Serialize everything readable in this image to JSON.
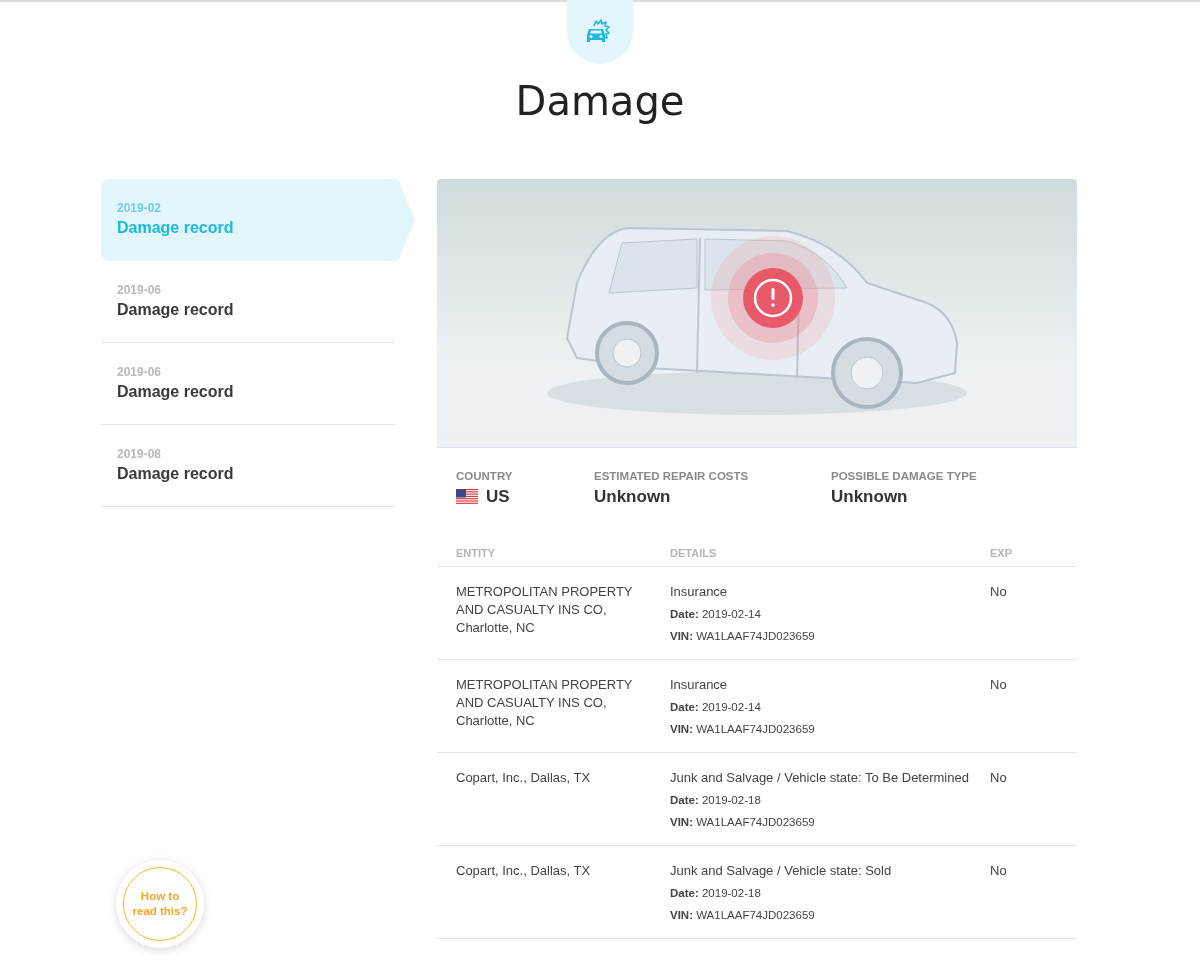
{
  "header": {
    "title": "Damage"
  },
  "records": [
    {
      "date": "2019-02",
      "label": "Damage record",
      "selected": true
    },
    {
      "date": "2019-06",
      "label": "Damage record",
      "selected": false
    },
    {
      "date": "2019-06",
      "label": "Damage record",
      "selected": false
    },
    {
      "date": "2019-08",
      "label": "Damage record",
      "selected": false
    }
  ],
  "summary": [
    {
      "kind": "flag",
      "label": "COUNTRY",
      "value": "US"
    },
    {
      "kind": "text",
      "label": "ESTIMATED REPAIR COSTS",
      "value": "Unknown"
    },
    {
      "kind": "text",
      "label": "POSSIBLE DAMAGE TYPE",
      "value": "Unknown"
    }
  ],
  "table": {
    "columns": [
      "ENTITY",
      "DETAILS",
      "EXP"
    ],
    "rows": [
      {
        "entity": "METROPOLITAN PROPERTY AND CASUALTY INS CO, Charlotte, NC",
        "details": "Insurance",
        "date": "**Date:** 2019-02-14",
        "vin": "**VIN:** WA1LAAF74JD023659",
        "exp": "No"
      },
      {
        "entity": "METROPOLITAN PROPERTY AND CASUALTY INS CO, Charlotte, NC",
        "details": "Insurance",
        "date": "**Date:** 2019-02-14",
        "vin": "**VIN:** WA1LAAF74JD023659",
        "exp": "No"
      },
      {
        "entity": "Copart, Inc., Dallas, TX",
        "details": "Junk and Salvage / Vehicle state: To Be Determined",
        "date": "**Date:** 2019-02-18",
        "vin": "**VIN:** WA1LAAF74JD023659",
        "exp": "No"
      },
      {
        "entity": "Copart, Inc., Dallas, TX",
        "details": "Junk and Salvage / Vehicle state: Sold",
        "date": "**Date:** 2019-02-18",
        "vin": "**VIN:** WA1LAAF74JD023659",
        "exp": "No"
      }
    ]
  },
  "help_button": {
    "label": "How to read this?"
  }
}
